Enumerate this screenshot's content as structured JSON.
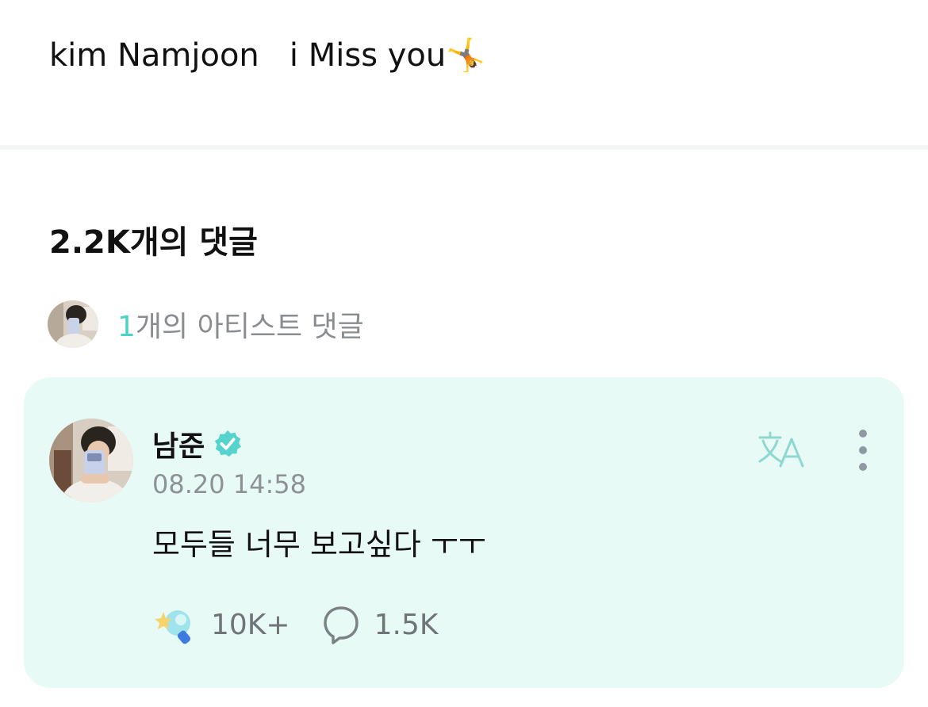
{
  "post": {
    "text": "kim Namjoon   i Miss you",
    "trailing_emoji": "🤸"
  },
  "comments": {
    "title": "2.2K개의 댓글",
    "artist_count_number": "1",
    "artist_count_suffix": "개의 아티스트 댓글"
  },
  "comment": {
    "author": "남준",
    "verified_icon": "verified-badge-icon",
    "timestamp": "08.20 14:58",
    "body": "모두들 너무 보고싶다 ㅜㅜ",
    "translate_icon": "translate-icon",
    "more_icon": "more-vertical-icon",
    "reaction_count": "10K+",
    "reply_count": "1.5K"
  },
  "colors": {
    "accent": "#4fd1c7",
    "card_bg": "#e8faf6",
    "muted_text": "#8a8d90"
  }
}
